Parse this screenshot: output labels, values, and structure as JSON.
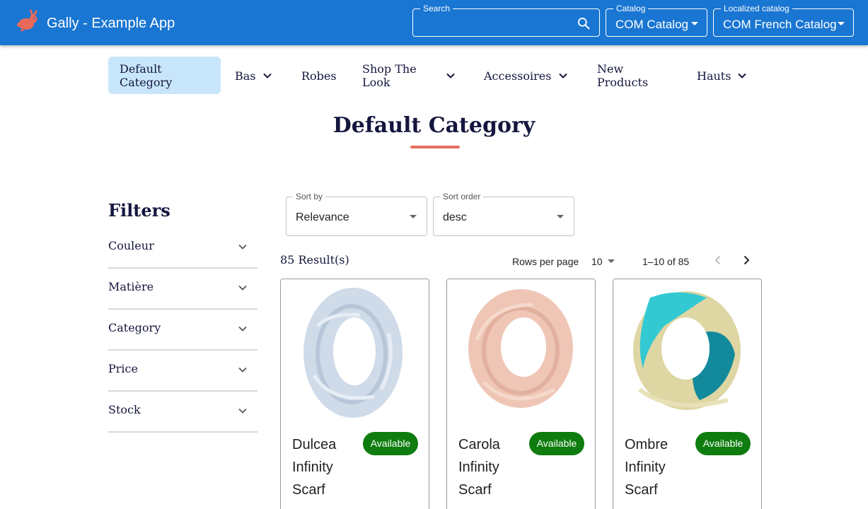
{
  "app": {
    "title": "Gally - Example App",
    "search_label": "Search",
    "search_value": "",
    "catalog_label": "Catalog",
    "catalog_value": "COM Catalog",
    "localized_label": "Localized catalog",
    "localized_value": "COM French Catalog"
  },
  "nav": {
    "items": [
      {
        "label": "Default Category",
        "active": true
      },
      {
        "label": "Bas",
        "has_children": true
      },
      {
        "label": "Robes"
      },
      {
        "label": "Shop The Look",
        "has_children": true
      },
      {
        "label": "Accessoires",
        "has_children": true
      },
      {
        "label": "New Products"
      },
      {
        "label": "Hauts",
        "has_children": true
      }
    ]
  },
  "page": {
    "title": "Default Category"
  },
  "filters": {
    "heading": "Filters",
    "items": [
      "Couleur",
      "Matière",
      "Category",
      "Price",
      "Stock"
    ]
  },
  "sort": {
    "by_label": "Sort by",
    "by_value": "Relevance",
    "order_label": "Sort order",
    "order_value": "desc"
  },
  "results": {
    "count": "85 Result(s)",
    "rows_per_page_label": "Rows per page",
    "rows_per_page_value": "10",
    "range": "1–10 of 85"
  },
  "products": [
    {
      "name": "Dulcea Infinity Scarf",
      "badge": "Available"
    },
    {
      "name": "Carola Infinity Scarf",
      "badge": "Available"
    },
    {
      "name": "Ombre Infinity Scarf",
      "badge": "Available"
    }
  ],
  "colors": {
    "appbar": "#1976d2",
    "nav_active_bg": "#c8e6fb",
    "accent_underline": "#e56e5e",
    "badge_green": "#0e7c0e",
    "heading_navy": "#14163e"
  }
}
